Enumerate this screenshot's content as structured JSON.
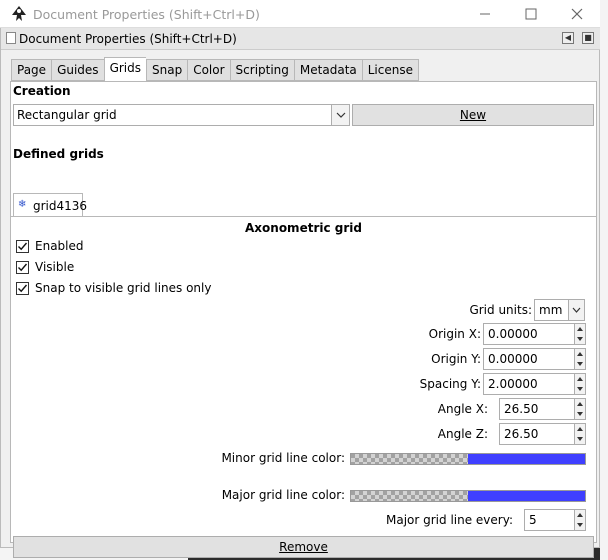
{
  "window": {
    "title": "Document Properties (Shift+Ctrl+D)"
  },
  "dock": {
    "title": "Document Properties (Shift+Ctrl+D)"
  },
  "tabs": [
    "Page",
    "Guides",
    "Grids",
    "Snap",
    "Color",
    "Scripting",
    "Metadata",
    "License"
  ],
  "active_tab": "Grids",
  "creation": {
    "heading": "Creation",
    "grid_type": "Rectangular grid",
    "new_button": "New"
  },
  "defined": {
    "heading": "Defined grids",
    "grid_tab": "grid4136",
    "grid_title": "Axonometric grid"
  },
  "checkboxes": {
    "enabled": {
      "label": "Enabled",
      "checked": true
    },
    "visible": {
      "label": "Visible",
      "checked": true
    },
    "snap": {
      "label": "Snap to visible grid lines only",
      "checked": true
    }
  },
  "fields": {
    "grid_units": {
      "label": "Grid units:",
      "value": "mm"
    },
    "origin_x": {
      "label": "Origin X:",
      "value": "0.00000"
    },
    "origin_y": {
      "label": "Origin Y:",
      "value": "0.00000"
    },
    "spacing_y": {
      "label": "Spacing Y:",
      "value": "2.00000"
    },
    "angle_x": {
      "label": "Angle X:",
      "value": "26.50"
    },
    "angle_z": {
      "label": "Angle Z:",
      "value": "26.50"
    },
    "minor_color": {
      "label": "Minor grid line color:",
      "color": "#3f3fff"
    },
    "major_color": {
      "label": "Major grid line color:",
      "color": "#3f3fff"
    },
    "major_every": {
      "label": "Major grid line every:",
      "value": "5"
    }
  },
  "remove_button": "Remove"
}
